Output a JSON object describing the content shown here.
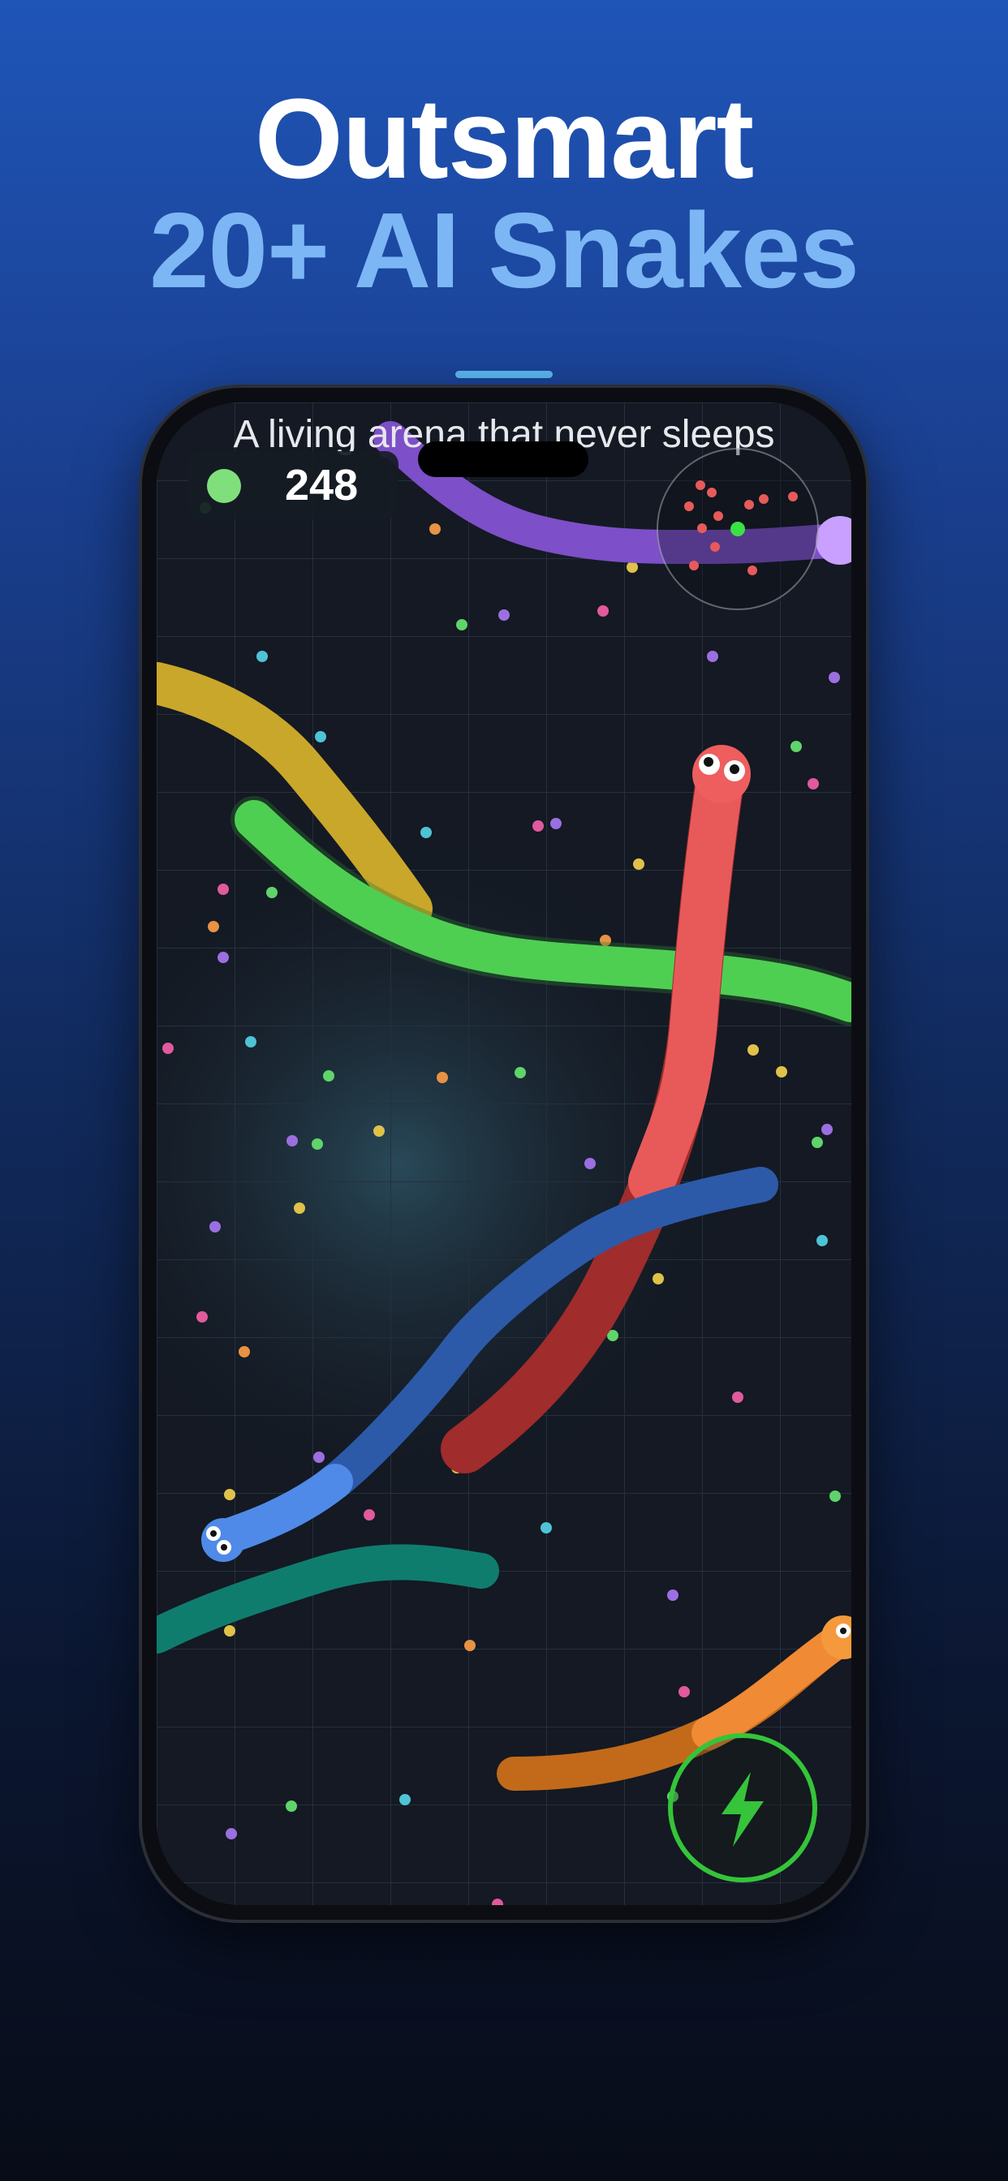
{
  "headline": {
    "line1": "Outsmart",
    "line2": "20+ AI Snakes"
  },
  "game": {
    "subtitle": "A living arena that never sleeps",
    "score": "248",
    "player_color": "#7fe07b",
    "boost_icon": "lightning-icon",
    "colors": {
      "boost": "#35c43a",
      "accent_bar": "#5ab8f2",
      "headline_highlight": "#7cb6f4"
    }
  }
}
